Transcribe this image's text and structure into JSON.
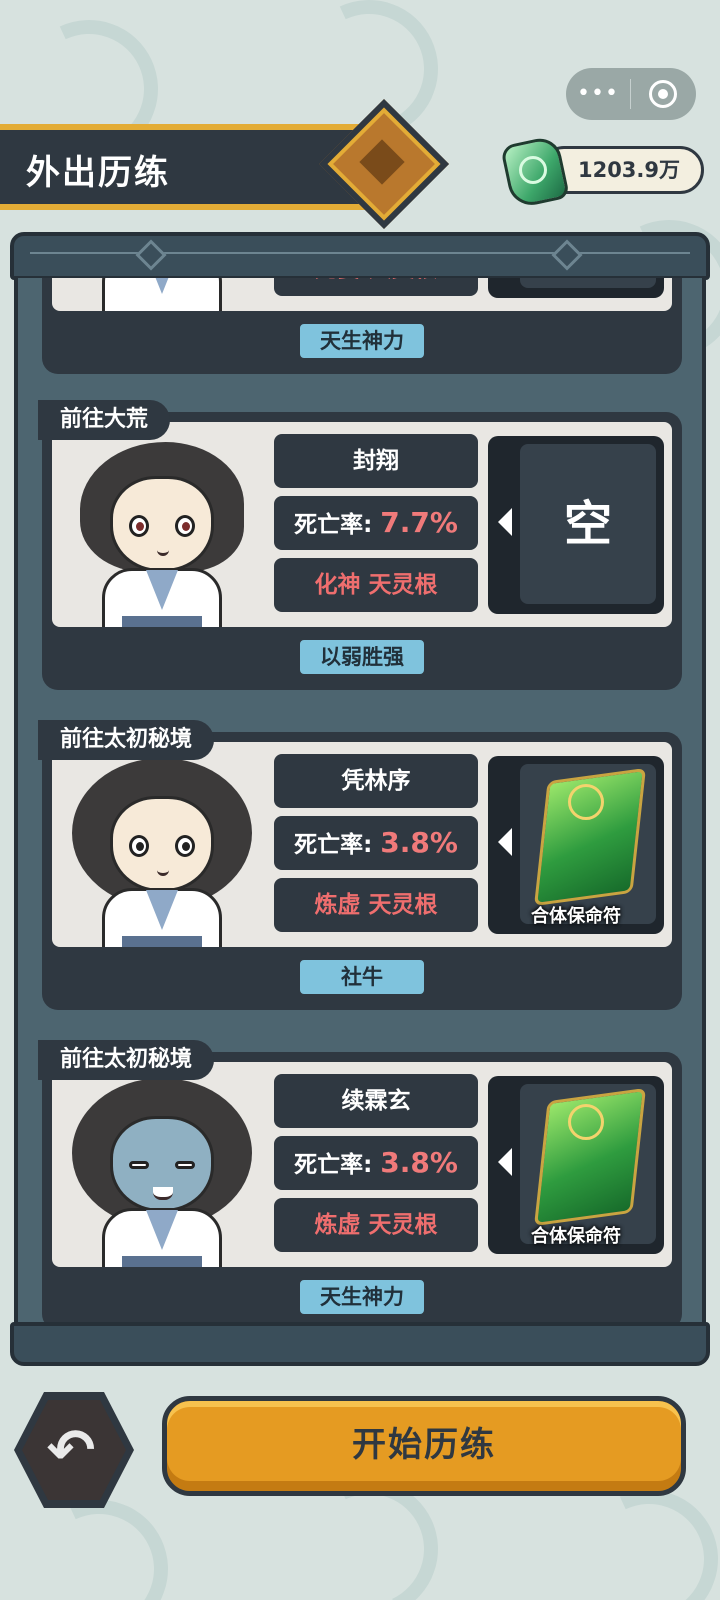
{
  "header": {
    "title": "外出历练",
    "currency_amount": "1203.9万"
  },
  "capsule": {
    "more": "•••"
  },
  "cards": [
    {
      "destination": "",
      "name": "",
      "death_rate_label": "",
      "death_rate_value": "",
      "rank": "元婴 天灵根",
      "slot_item": "",
      "trait": "天生神力"
    },
    {
      "destination": "前往大荒",
      "name": "封翔",
      "death_rate_label": "死亡率:",
      "death_rate_value": "7.7%",
      "rank": "化神 天灵根",
      "slot_item": "空",
      "trait": "以弱胜强"
    },
    {
      "destination": "前往太初秘境",
      "name": "凭林序",
      "death_rate_label": "死亡率:",
      "death_rate_value": "3.8%",
      "rank": "炼虚 天灵根",
      "slot_item": "合体保命符",
      "trait": "社牛"
    },
    {
      "destination": "前往太初秘境",
      "name": "续霖玄",
      "death_rate_label": "死亡率:",
      "death_rate_value": "3.8%",
      "rank": "炼虚 天灵根",
      "slot_item": "合体保命符",
      "trait": "天生神力"
    }
  ],
  "footer": {
    "start_label": "开始历练"
  },
  "icons": {
    "back": "back-arrow-icon",
    "currency": "jade-gem-icon",
    "talisman": "talisman-icon"
  },
  "colors": {
    "background": "#d7e2df",
    "panel": "#4d6570",
    "dark": "#2f3841",
    "accent_gold": "#e3ac36",
    "start_button": "#e59b22",
    "death_rate": "#f07a7a",
    "trait_badge": "#7fc3dd"
  }
}
